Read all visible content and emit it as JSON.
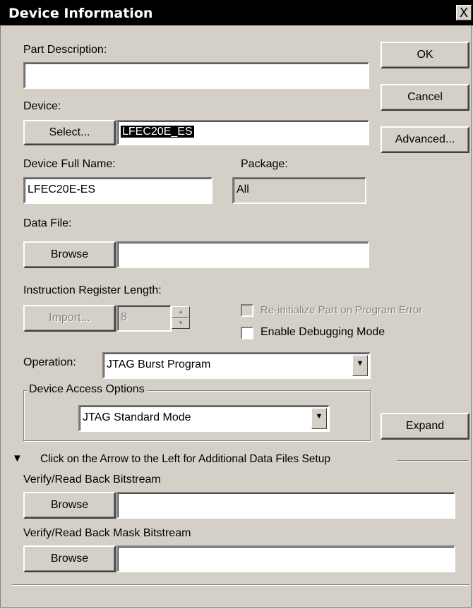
{
  "window": {
    "title": "Device Information",
    "close_glyph": "X"
  },
  "part_description": {
    "label": "Part Description:",
    "value": ""
  },
  "device": {
    "label": "Device:",
    "select_button": "Select...",
    "value": "LFEC20E_ES"
  },
  "device_full_name": {
    "label": "Device Full Name:",
    "value": "LFEC20E-ES"
  },
  "package": {
    "label": "Package:",
    "value": "All"
  },
  "data_file": {
    "label": "Data File:",
    "browse_button": "Browse",
    "value": ""
  },
  "instruction_register": {
    "label": "Instruction Register Length:",
    "import_button": "Import...",
    "value": "8"
  },
  "options": {
    "reinitialize": "Re-initialize Part on Program Error",
    "debugging": "Enable Debugging  Mode"
  },
  "operation": {
    "label": "Operation:",
    "value": "JTAG Burst Program"
  },
  "device_access": {
    "label": "Device Access Options",
    "value": "JTAG Standard Mode"
  },
  "buttons": {
    "ok": "OK",
    "cancel": "Cancel",
    "advanced": "Advanced...",
    "expand": "Expand"
  },
  "additional_files": {
    "arrow_glyph": "▼",
    "header": "Click on the Arrow to the Left for Additional Data Files Setup",
    "verify_label": "Verify/Read Back Bitstream",
    "verify_browse": "Browse",
    "verify_value": "",
    "mask_label": "Verify/Read Back Mask Bitstream",
    "mask_browse": "Browse",
    "mask_value": ""
  }
}
